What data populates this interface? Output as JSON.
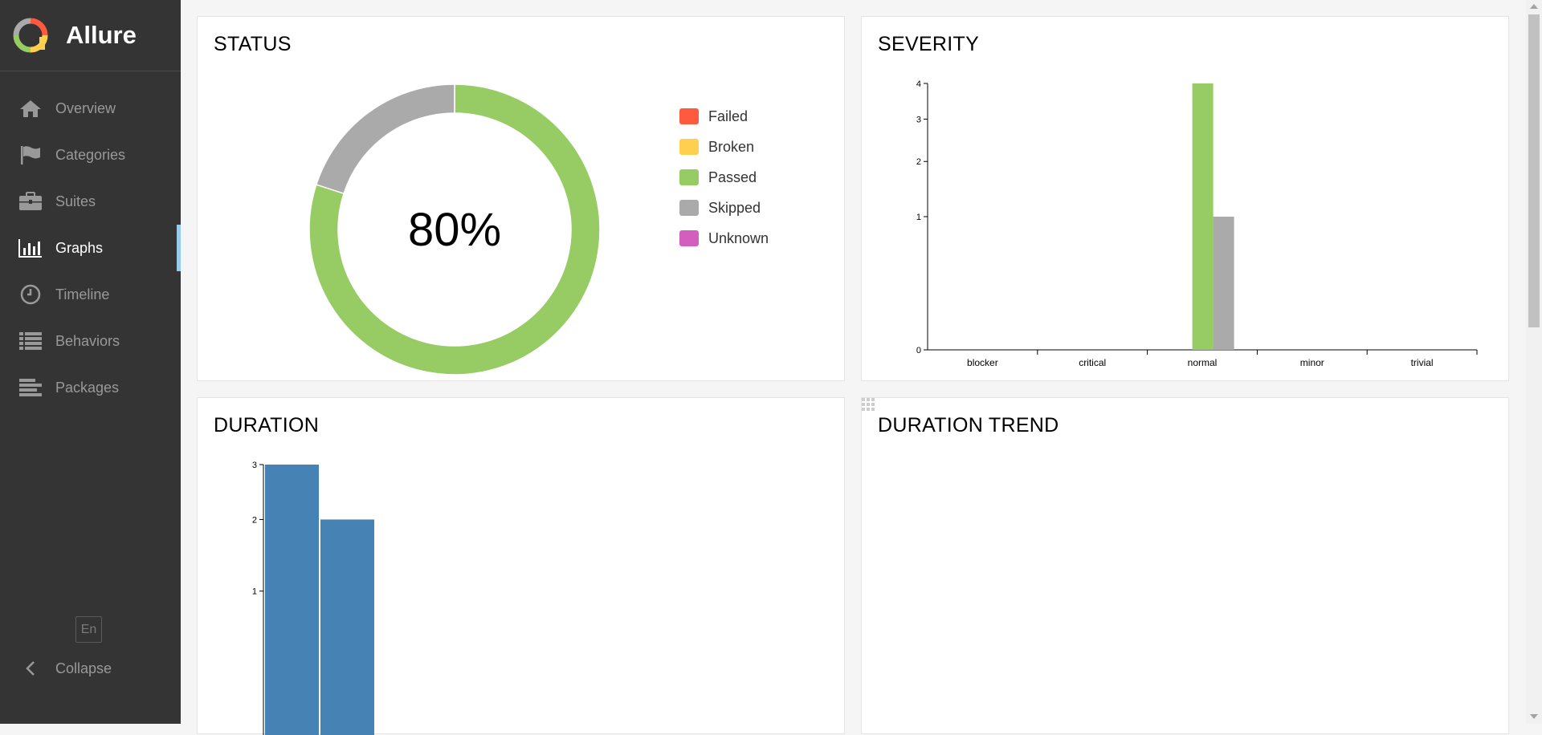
{
  "app": {
    "brand": "Allure"
  },
  "sidebar": {
    "items": [
      {
        "label": "Overview",
        "icon": "home-icon"
      },
      {
        "label": "Categories",
        "icon": "flag-icon"
      },
      {
        "label": "Suites",
        "icon": "briefcase-icon"
      },
      {
        "label": "Graphs",
        "icon": "bar-chart-icon",
        "active": true
      },
      {
        "label": "Timeline",
        "icon": "clock-icon"
      },
      {
        "label": "Behaviors",
        "icon": "list-icon"
      },
      {
        "label": "Packages",
        "icon": "align-left-icon"
      }
    ],
    "language": "En",
    "collapse_label": "Collapse"
  },
  "colors": {
    "failed": "#fd5a3e",
    "broken": "#ffd050",
    "passed": "#97cc64",
    "skipped": "#aaaaaa",
    "unknown": "#d35ebe",
    "duration_bar": "#4682b4",
    "sidebar_bg": "#343434",
    "active_marker": "#97cbec"
  },
  "status": {
    "title": "STATUS",
    "center_label": "80%",
    "legend": [
      {
        "label": "Failed",
        "color": "#fd5a3e"
      },
      {
        "label": "Broken",
        "color": "#ffd050"
      },
      {
        "label": "Passed",
        "color": "#97cc64"
      },
      {
        "label": "Skipped",
        "color": "#aaaaaa"
      },
      {
        "label": "Unknown",
        "color": "#d35ebe"
      }
    ]
  },
  "severity": {
    "title": "SEVERITY"
  },
  "duration": {
    "title": "DURATION"
  },
  "duration_trend": {
    "title": "DURATION TREND",
    "icon": "grid-icon"
  },
  "chart_data": [
    {
      "type": "pie",
      "title": "STATUS",
      "center_label": "80%",
      "categories": [
        "Failed",
        "Broken",
        "Passed",
        "Skipped",
        "Unknown"
      ],
      "values": [
        0,
        0,
        4,
        1,
        0
      ],
      "colors": [
        "#fd5a3e",
        "#ffd050",
        "#97cc64",
        "#aaaaaa",
        "#d35ebe"
      ],
      "legend_position": "right"
    },
    {
      "type": "bar",
      "title": "SEVERITY",
      "categories": [
        "blocker",
        "critical",
        "normal",
        "minor",
        "trivial"
      ],
      "series": [
        {
          "values": [
            0,
            0,
            0,
            0,
            0
          ],
          "color": "#fd5a3e"
        },
        {
          "values": [
            0,
            0,
            0,
            0,
            0
          ],
          "color": "#ffd050"
        },
        {
          "values": [
            0,
            0,
            4,
            0,
            0
          ],
          "color": "#97cc64"
        },
        {
          "values": [
            0,
            0,
            1,
            0,
            0
          ],
          "color": "#aaaaaa"
        },
        {
          "values": [
            0,
            0,
            0,
            0,
            0
          ],
          "color": "#d35ebe"
        }
      ],
      "y_scale": "sqrt",
      "ylim": [
        0,
        4
      ],
      "yticks": [
        0,
        1,
        2,
        3,
        4
      ]
    },
    {
      "type": "bar",
      "title": "DURATION",
      "values": [
        3,
        2
      ],
      "color": "#4682b4",
      "y_scale": "sqrt",
      "yticks": [
        1,
        2,
        3
      ]
    }
  ]
}
